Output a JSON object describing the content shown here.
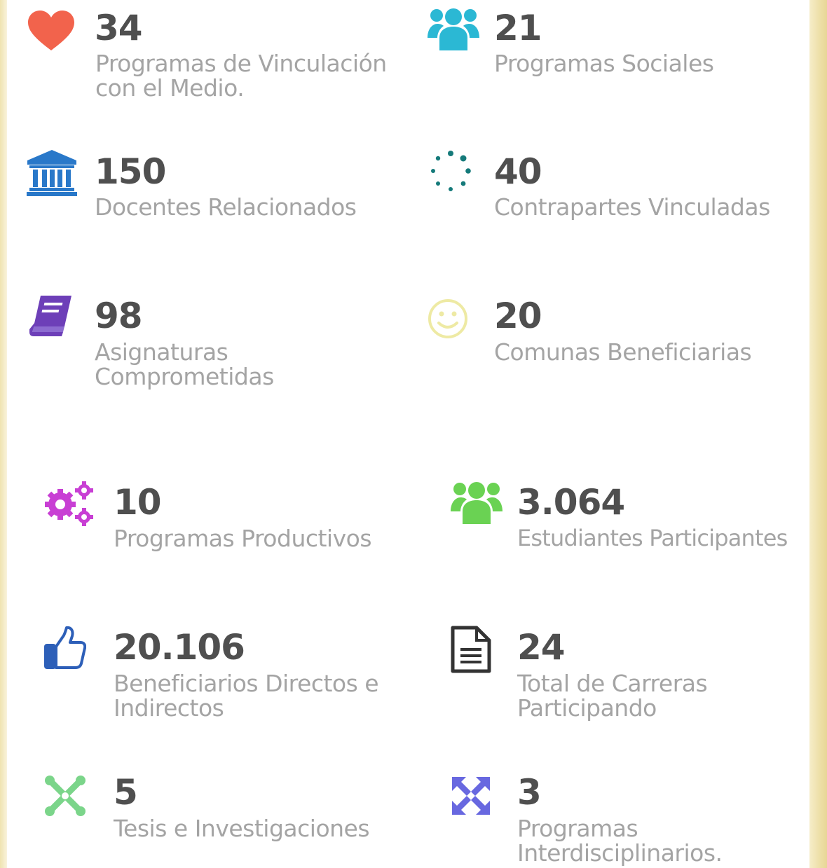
{
  "colors": {
    "number": "#4f4f4f",
    "label": "#a4a4a4",
    "heart": "#f2634c",
    "users_teal": "#2bb8d4",
    "bank": "#2978c9",
    "spinner": "#157a7a",
    "book": "#6d3fb8",
    "smile": "#eeeaa4",
    "cogs": "#c83fd4",
    "users_green": "#6ad253",
    "thumb": "#2d5fb8",
    "file": "#333333",
    "joomla": "#7bd58a",
    "arrows": "#6868e0"
  },
  "stats": [
    {
      "value": "34",
      "label": "Programas de Vinculación con el Medio.",
      "icon": "heart-icon"
    },
    {
      "value": "21",
      "label": "Programas Sociales",
      "icon": "users-icon"
    },
    {
      "value": "150",
      "label": "Docentes Relacionados",
      "icon": "bank-icon"
    },
    {
      "value": "40",
      "label": "Contrapartes Vinculadas",
      "icon": "spinner-icon"
    },
    {
      "value": "98",
      "label": "Asignaturas Comprometidas",
      "icon": "book-icon"
    },
    {
      "value": "20",
      "label": "Comunas Beneficiarias",
      "icon": "smile-icon"
    },
    {
      "value": "10",
      "label": "Programas Productivos",
      "icon": "cogs-icon"
    },
    {
      "value": "3.064",
      "label": "Estudiantes Participantes",
      "icon": "users-icon"
    },
    {
      "value": "20.106",
      "label": "Beneficiarios Directos e Indirectos",
      "icon": "thumbs-up-icon"
    },
    {
      "value": "24",
      "label": "Total de Carreras Participando",
      "icon": "file-text-icon"
    },
    {
      "value": "5",
      "label": "Tesis e Investigaciones",
      "icon": "joomla-icon"
    },
    {
      "value": "3",
      "label": "Programas Interdisciplinarios.",
      "icon": "arrows-alt-icon"
    }
  ]
}
